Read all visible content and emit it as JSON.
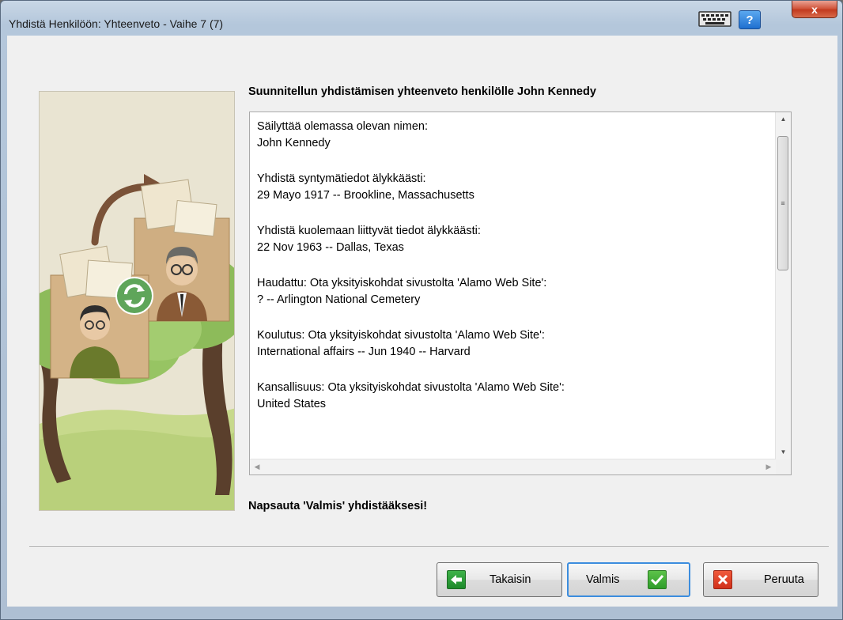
{
  "window": {
    "title": "Yhdistä Henkilöön: Yhteenveto - Vaihe 7 (7)",
    "help_label": "?",
    "close_label": "x"
  },
  "heading": "Suunnitellun yhdistämisen yhteenveto henkilölle John Kennedy",
  "summary": {
    "blocks": [
      {
        "label": "Säilyttää olemassa olevan nimen:",
        "value": "John Kennedy"
      },
      {
        "label": "Yhdistä syntymätiedot älykkäästi:",
        "value": "29 Mayo 1917 -- Brookline, Massachusetts"
      },
      {
        "label": "Yhdistä kuolemaan liittyvät tiedot älykkäästi:",
        "value": "22 Nov 1963 -- Dallas, Texas"
      },
      {
        "label": "Haudattu: Ota yksityiskohdat sivustolta 'Alamo Web Site':",
        "value": "? -- Arlington National Cemetery"
      },
      {
        "label": "Koulutus: Ota yksityiskohdat sivustolta 'Alamo Web Site':",
        "value": "International affairs -- Jun 1940 -- Harvard"
      },
      {
        "label": "Kansallisuus: Ota yksityiskohdat sivustolta 'Alamo Web Site':",
        "value": "United States"
      }
    ]
  },
  "finish_note": "Napsauta 'Valmis' yhdistääksesi!",
  "buttons": {
    "back": "Takaisin",
    "finish": "Valmis",
    "cancel": "Peruuta"
  },
  "icons": {
    "keyboard": "keyboard-icon",
    "help": "help-icon",
    "close": "close-icon",
    "back": "back-arrow-icon",
    "finish": "checkmark-icon",
    "cancel": "cancel-x-icon"
  }
}
